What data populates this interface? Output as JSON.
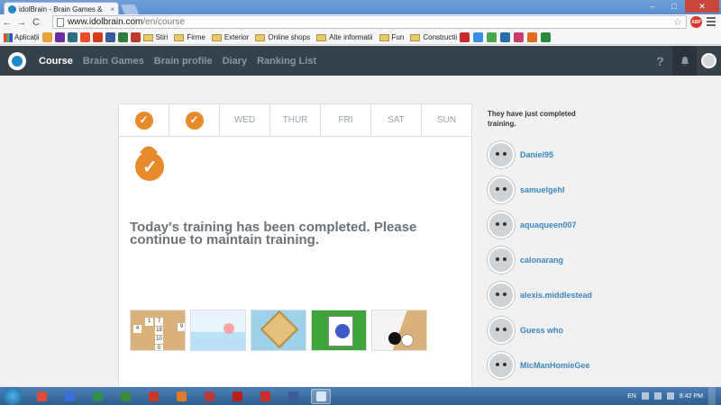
{
  "browser": {
    "tab_title": "idolBrain - Brain Games &",
    "tab_close": "×",
    "window_controls": {
      "minimize": "‒",
      "maximize": "□",
      "close": "✕"
    },
    "nav": {
      "back": "←",
      "forward": "→",
      "reload": "C"
    },
    "url_host": "www.idolbrain.com",
    "url_path": "/en/course",
    "star": "☆",
    "abp_label": "ABP"
  },
  "bookmarks": {
    "apps_label": "Aplicații",
    "folders": [
      "Stiri",
      "Firme",
      "Exterior",
      "Online shops",
      "Alte informatii",
      "Fun",
      "Constructii"
    ],
    "icon_colors_left": [
      "#e8a33b",
      "#6b2fa0",
      "#2f6e8a",
      "#ef4b24",
      "#d63a1f",
      "#3b5998",
      "#2c7f3a",
      "#c0392b"
    ],
    "icon_colors_right": [
      "#c92b2b",
      "#3a8ee6",
      "#4aa84a",
      "#2a6fa8",
      "#c93b6a",
      "#e36b1f",
      "#2b8a3e"
    ]
  },
  "appnav": {
    "links": [
      "Course",
      "Brain Games",
      "Brain profile",
      "Diary",
      "Ranking List"
    ],
    "active_index": 0,
    "help": "?",
    "bell": "🔔"
  },
  "week": {
    "days": [
      "",
      "",
      "WED",
      "THUR",
      "FRI",
      "SAT",
      "SUN"
    ],
    "completed": [
      true,
      true,
      false,
      false,
      false,
      false,
      false
    ]
  },
  "main": {
    "message": "Today's training has been completed. Please continue to maintain training.",
    "grid_numbers": [
      "4",
      "1",
      "7",
      "18",
      "9",
      "10",
      "5"
    ]
  },
  "sidebar": {
    "title": "They have just completed training.",
    "users": [
      "Daniel95",
      "samuelgehl",
      "aquaqueen007",
      "calonarang",
      "alexis.middlestead",
      "Guess who",
      "MicManHomieGee"
    ]
  },
  "taskbar": {
    "lang": "EN",
    "time": "8:42 PM",
    "app_colors": [
      "#e04a3a",
      "#3a6fd8",
      "#2f8f4f",
      "#3c8a3c",
      "#c63a2a",
      "#e07a2a",
      "#b83a3a",
      "#b82020",
      "#d02a2a",
      "#3a5a9a",
      "#d8e8f8"
    ]
  },
  "colors": {
    "accent_orange": "#e8892c",
    "link_blue": "#3b86c4",
    "nav_bg": "#37414a"
  }
}
